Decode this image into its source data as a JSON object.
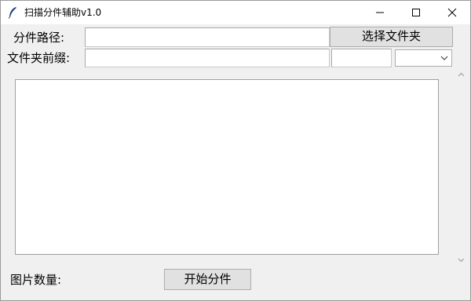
{
  "window": {
    "title": "扫描分件辅助v1.0"
  },
  "form": {
    "path_label": "分件路径:",
    "path_value": "",
    "select_folder_button": "选择文件夹",
    "prefix_label": "文件夹前缀:",
    "prefix_value": "",
    "extra_value": "",
    "combo_value": ""
  },
  "log": {
    "text": ""
  },
  "footer": {
    "image_count_label": "图片数量:",
    "start_button": "开始分件"
  },
  "icons": {
    "app": "feather-icon",
    "minimize": "minimize-icon",
    "maximize": "maximize-icon",
    "close": "close-icon",
    "combo_arrow": "chevron-down-icon",
    "scroll_up": "chevron-up-icon",
    "scroll_down": "chevron-down-icon"
  }
}
